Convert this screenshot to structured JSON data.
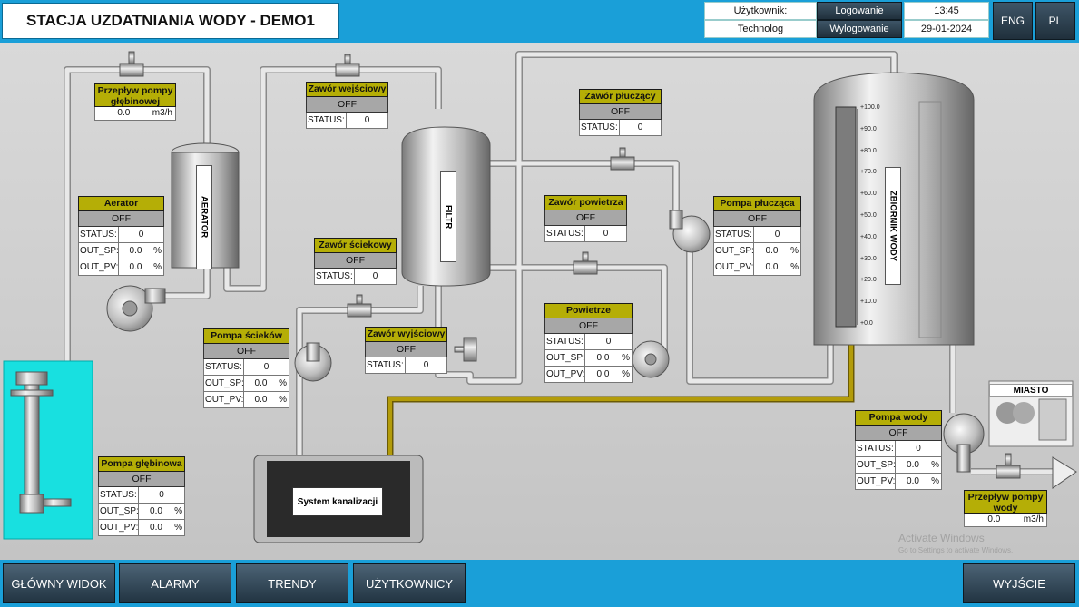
{
  "header": {
    "title": "STACJA UZDATNIANIA WODY - DEMO1",
    "user_label": "Użytkownik:",
    "user_value": "Technolog",
    "login_button": "Logowanie",
    "logout_button": "Wylogowanie",
    "time": "13:45",
    "date": "29-01-2024",
    "lang_eng": "ENG",
    "lang_pl": "PL"
  },
  "equipment": {
    "aerator_label": "AERATOR",
    "filter_label": "FILTR",
    "tank_label": "ZBIORNIK WODY",
    "sewage_label": "System kanalizacji",
    "city_label": "MIASTO",
    "tank_scale": [
      "+100.0",
      "+90.0",
      "+80.0",
      "+70.0",
      "+60.0",
      "+50.0",
      "+40.0",
      "+30.0",
      "+20.0",
      "+10.0",
      "+0.0"
    ],
    "tank_level_percent": 0
  },
  "panels": {
    "deep_pump_flow": {
      "title_line1": "Przepływ pompy",
      "title_line2": "głębinowej",
      "value": "0.0",
      "unit": "m3/h"
    },
    "water_pump_flow": {
      "title_line1": "Przepływ pompy",
      "title_line2": "wody",
      "value": "0.0",
      "unit": "m3/h"
    },
    "inlet_valve": {
      "title": "Zawór wejściowy",
      "state": "OFF",
      "status_label": "STATUS:",
      "status": "0"
    },
    "flush_valve": {
      "title": "Zawór płuczący",
      "state": "OFF",
      "status_label": "STATUS:",
      "status": "0"
    },
    "air_valve": {
      "title": "Zawór powietrza",
      "state": "OFF",
      "status_label": "STATUS:",
      "status": "0"
    },
    "sewage_valve": {
      "title": "Zawór ściekowy",
      "state": "OFF",
      "status_label": "STATUS:",
      "status": "0"
    },
    "outlet_valve": {
      "title": "Zawór wyjściowy",
      "state": "OFF",
      "status_label": "STATUS:",
      "status": "0"
    },
    "aerator": {
      "title": "Aerator",
      "state": "OFF",
      "status_label": "STATUS:",
      "status": "0",
      "sp_label": "OUT_SP:",
      "sp": "0.0",
      "pv_label": "OUT_PV:",
      "pv": "0.0",
      "unit": "%"
    },
    "sewage_pump": {
      "title": "Pompa ścieków",
      "state": "OFF",
      "status_label": "STATUS:",
      "status": "0",
      "sp_label": "OUT_SP:",
      "sp": "0.0",
      "pv_label": "OUT_PV:",
      "pv": "0.0",
      "unit": "%"
    },
    "air": {
      "title": "Powietrze",
      "state": "OFF",
      "status_label": "STATUS:",
      "status": "0",
      "sp_label": "OUT_SP:",
      "sp": "0.0",
      "pv_label": "OUT_PV:",
      "pv": "0.0",
      "unit": "%"
    },
    "flush_pump": {
      "title": "Pompa płucząca",
      "state": "OFF",
      "status_label": "STATUS:",
      "status": "0",
      "sp_label": "OUT_SP:",
      "sp": "0.0",
      "pv_label": "OUT_PV:",
      "pv": "0.0",
      "unit": "%"
    },
    "deep_pump": {
      "title": "Pompa głębinowa",
      "state": "OFF",
      "status_label": "STATUS:",
      "status": "0",
      "sp_label": "OUT_SP:",
      "sp": "0.0",
      "pv_label": "OUT_PV:",
      "pv": "0.0",
      "unit": "%"
    },
    "water_pump": {
      "title": "Pompa wody",
      "state": "OFF",
      "status_label": "STATUS:",
      "status": "0",
      "sp_label": "OUT_SP:",
      "sp": "0.0",
      "pv_label": "OUT_PV:",
      "pv": "0.0",
      "unit": "%"
    }
  },
  "footer": {
    "main_view": "GŁÓWNY WIDOK",
    "alarms": "ALARMY",
    "trends": "TRENDY",
    "users": "UŻYTKOWNICY",
    "exit": "WYJŚCIE"
  },
  "watermark": {
    "line1": "Activate Windows",
    "line2": "Go to Settings to activate Windows."
  },
  "colors": {
    "accent_blue": "#1a9fd8",
    "panel_title": "#b5ae06",
    "sewage_pipe": "#a08a08",
    "pipe": "#e6e6e6"
  }
}
